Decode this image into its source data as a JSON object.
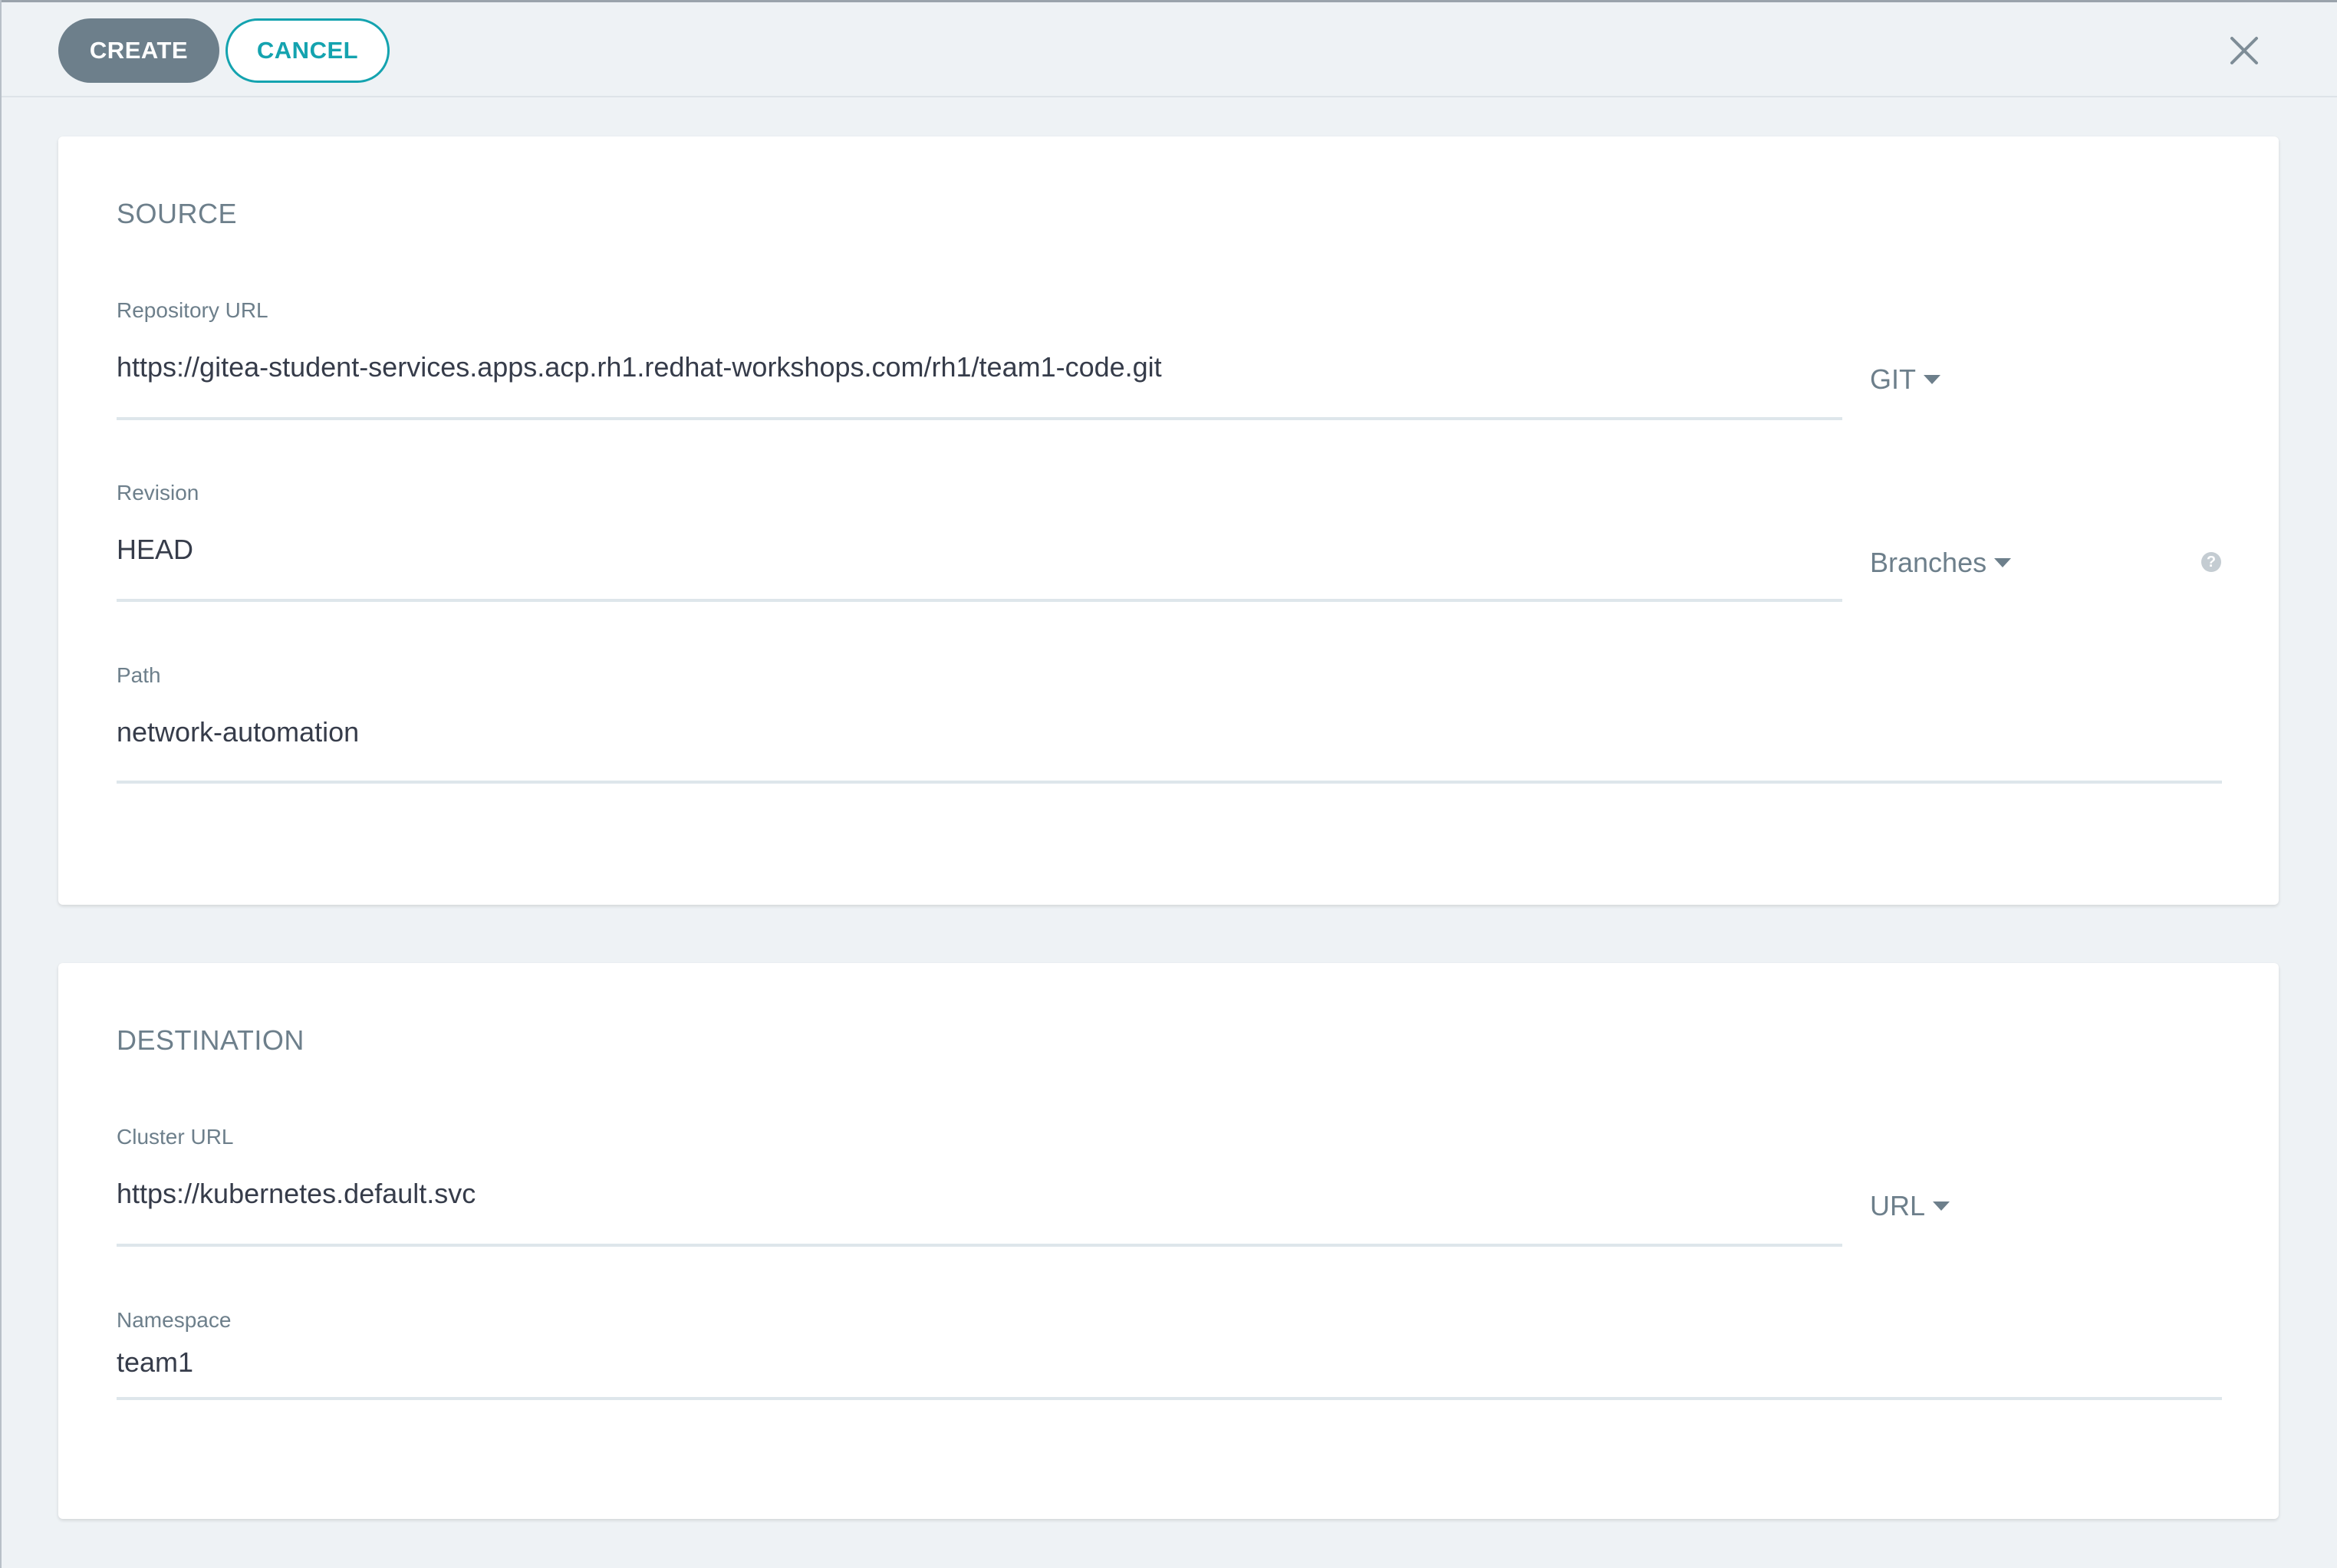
{
  "toolbar": {
    "create_label": "CREATE",
    "cancel_label": "CANCEL"
  },
  "source": {
    "title": "SOURCE",
    "repository_url": {
      "label": "Repository URL",
      "value": "https://gitea-student-services.apps.acp.rh1.redhat-workshops.com/rh1/team1-code.git",
      "type_selected": "GIT"
    },
    "revision": {
      "label": "Revision",
      "value": "HEAD",
      "type_selected": "Branches",
      "help_glyph": "?"
    },
    "path": {
      "label": "Path",
      "value": "network-automation"
    }
  },
  "destination": {
    "title": "DESTINATION",
    "cluster_url": {
      "label": "Cluster URL",
      "value": "https://kubernetes.default.svc",
      "type_selected": "URL"
    },
    "namespace": {
      "label": "Namespace",
      "value": "team1"
    }
  },
  "colors": {
    "primary_button": "#6d7f8b",
    "accent": "#14a3af",
    "background": "#eef2f5"
  }
}
